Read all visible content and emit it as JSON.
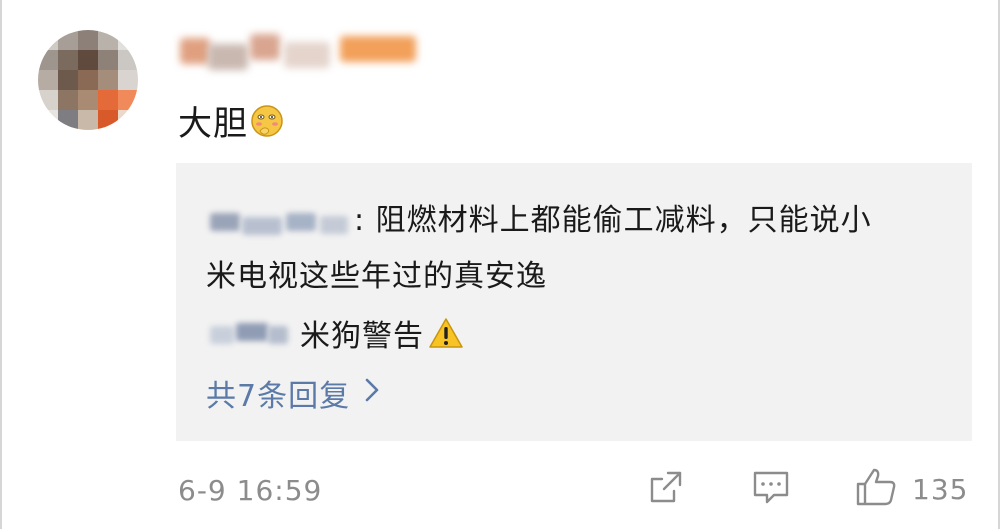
{
  "comment": {
    "text": "大胆",
    "emoji": "shy-face-emoji",
    "timestamp": "6-9 16:59",
    "like_count": "135"
  },
  "replies": {
    "first_reply_line1": ": 阻燃材料上都能偷工减料，只能说小",
    "first_reply_line2": "米电视这些年过的真安逸",
    "second_reply": "米狗警告",
    "second_reply_emoji": "warning-emoji",
    "more_label": "共7条回复"
  },
  "icons": {
    "share": "share-icon",
    "reply": "comment-icon",
    "like": "thumbs-up-icon",
    "more": "chevron-right-icon"
  },
  "colors": {
    "link": "#5b7aa8",
    "muted": "#8c8c8c",
    "reply_bg": "#f2f2f2"
  }
}
